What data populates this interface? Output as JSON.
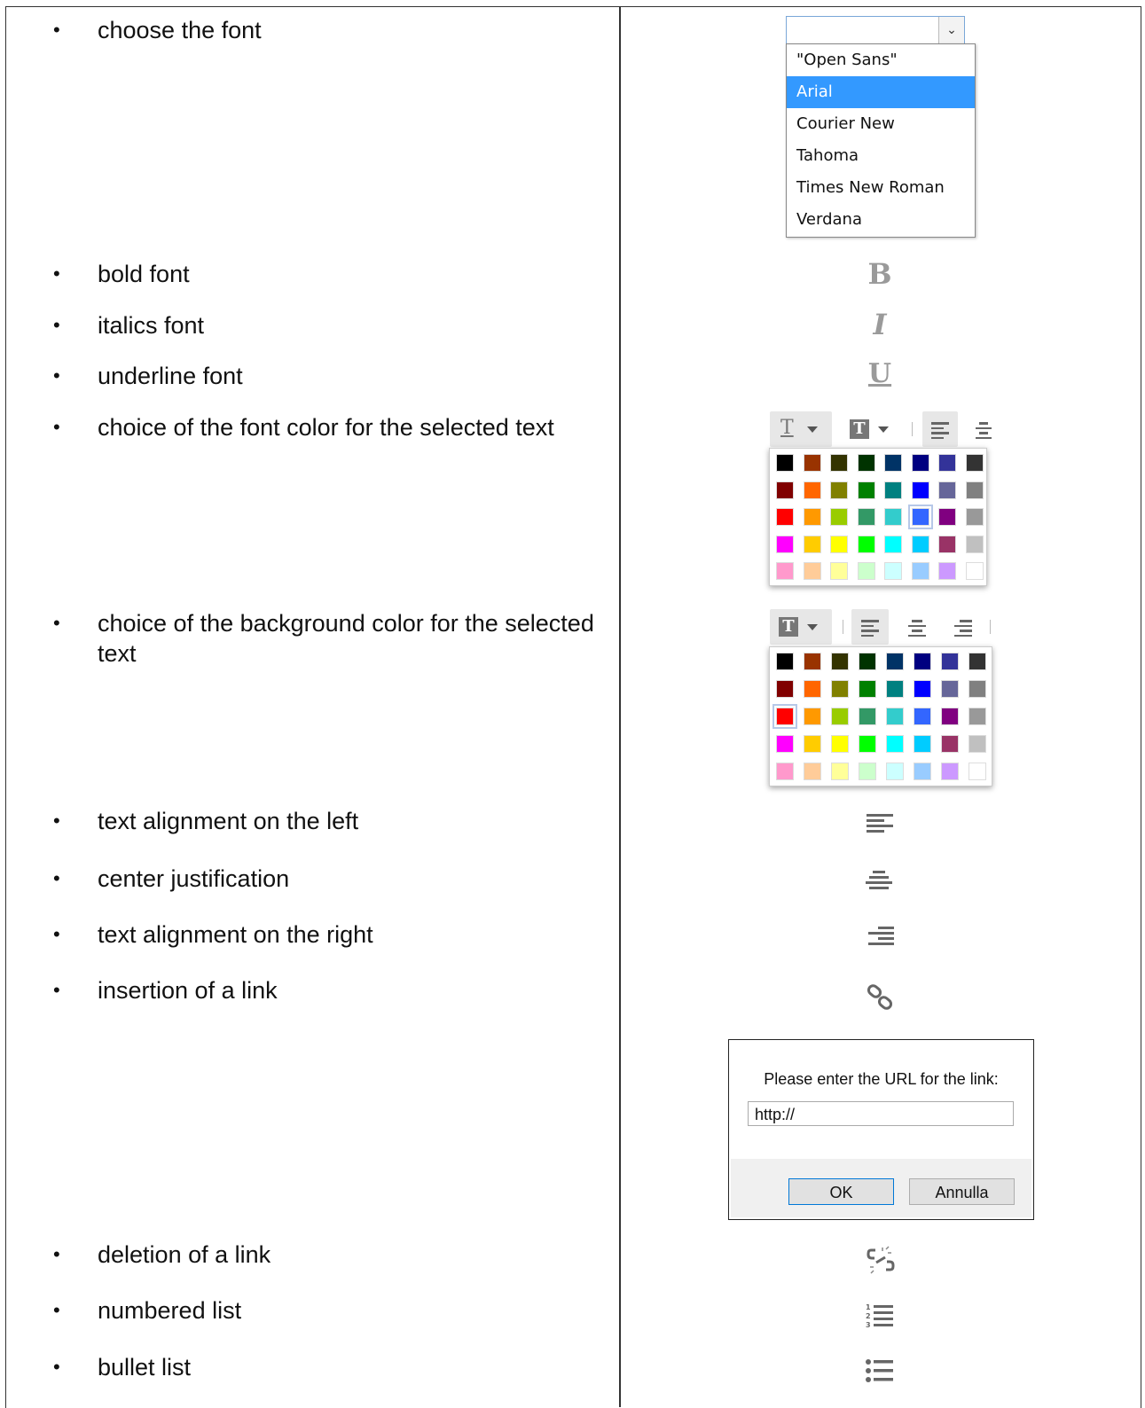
{
  "features": [
    {
      "text": "choose the font"
    },
    {
      "text": "bold font"
    },
    {
      "text": "italics font"
    },
    {
      "text": "underline font"
    },
    {
      "text": "choice of the font color for the selected text"
    },
    {
      "text": "choice of the background color for the selected text"
    },
    {
      "text": "text alignment on the left"
    },
    {
      "text": "center justification"
    },
    {
      "text": "text alignment on the right"
    },
    {
      "text": "insertion of a link"
    },
    {
      "text": "deletion of a link"
    },
    {
      "text": "numbered list"
    },
    {
      "text": "bullet list"
    }
  ],
  "bullet": "•",
  "font_dropdown": {
    "current_value": "",
    "options": [
      "\"Open Sans\"",
      "Arial",
      "Courier New",
      "Tahoma",
      "Times New Roman",
      "Verdana"
    ],
    "selected_index": 1
  },
  "format_icons": {
    "bold": "B",
    "italic": "I",
    "underline": "U"
  },
  "palette_colors": [
    [
      "#000000",
      "#993300",
      "#333300",
      "#003300",
      "#003366",
      "#000080",
      "#333399",
      "#333333"
    ],
    [
      "#800000",
      "#FF6600",
      "#808000",
      "#008000",
      "#008080",
      "#0000FF",
      "#666699",
      "#808080"
    ],
    [
      "#FF0000",
      "#FF9900",
      "#99CC00",
      "#339966",
      "#33CCCC",
      "#3366FF",
      "#800080",
      "#999999"
    ],
    [
      "#FF00FF",
      "#FFCC00",
      "#FFFF00",
      "#00FF00",
      "#00FFFF",
      "#00CCFF",
      "#993366",
      "#C0C0C0"
    ],
    [
      "#FF99CC",
      "#FFCC99",
      "#FFFF99",
      "#CCFFCC",
      "#CCFFFF",
      "#99CCFF",
      "#CC99FF",
      "#FFFFFF"
    ]
  ],
  "font_color_palette": {
    "highlighted": "#3366FF"
  },
  "background_color_palette": {
    "highlighted": "#FF0000"
  },
  "link_dialog": {
    "message": "Please enter the URL for the link:",
    "url_value": "http://",
    "ok_label": "OK",
    "cancel_label": "Annulla"
  }
}
